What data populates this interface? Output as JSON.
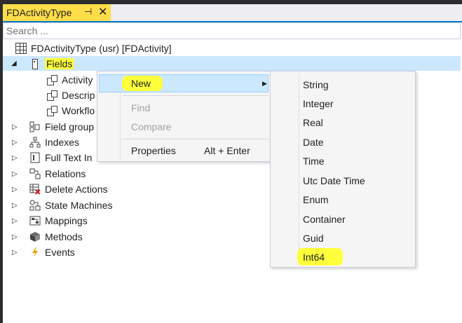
{
  "window": {
    "tab_title": "FDActivityType",
    "pin_glyph": "⊣",
    "close_glyph": "✕"
  },
  "search": {
    "placeholder": "Search ..."
  },
  "tree": {
    "root": "FDActivityType (usr) [FDActivity]",
    "fields_node": "Fields",
    "field_children": [
      "Activity",
      "Descrip",
      "Workflo"
    ],
    "nodes": [
      {
        "label": "Field group",
        "icon": "field-group-icon"
      },
      {
        "label": "Indexes",
        "icon": "indexes-icon"
      },
      {
        "label": "Full Text In",
        "icon": "full-text-index-icon"
      },
      {
        "label": "Relations",
        "icon": "relations-icon"
      },
      {
        "label": "Delete Actions",
        "icon": "delete-actions-icon"
      },
      {
        "label": "State Machines",
        "icon": "state-machines-icon"
      },
      {
        "label": "Mappings",
        "icon": "mappings-icon"
      },
      {
        "label": "Methods",
        "icon": "methods-icon"
      },
      {
        "label": "Events",
        "icon": "events-icon"
      }
    ]
  },
  "context_menu": {
    "new": "New",
    "find": "Find",
    "compare": "Compare",
    "properties": "Properties",
    "properties_shortcut": "Alt + Enter"
  },
  "submenu": {
    "items": [
      "String",
      "Integer",
      "Real",
      "Date",
      "Time",
      "Utc Date Time",
      "Enum",
      "Container",
      "Guid",
      "Int64"
    ]
  },
  "colors": {
    "highlight": "#ffff3b",
    "tab_active": "#ffde4a",
    "selection": "#cce8ff",
    "frame": "#2d2d30"
  }
}
